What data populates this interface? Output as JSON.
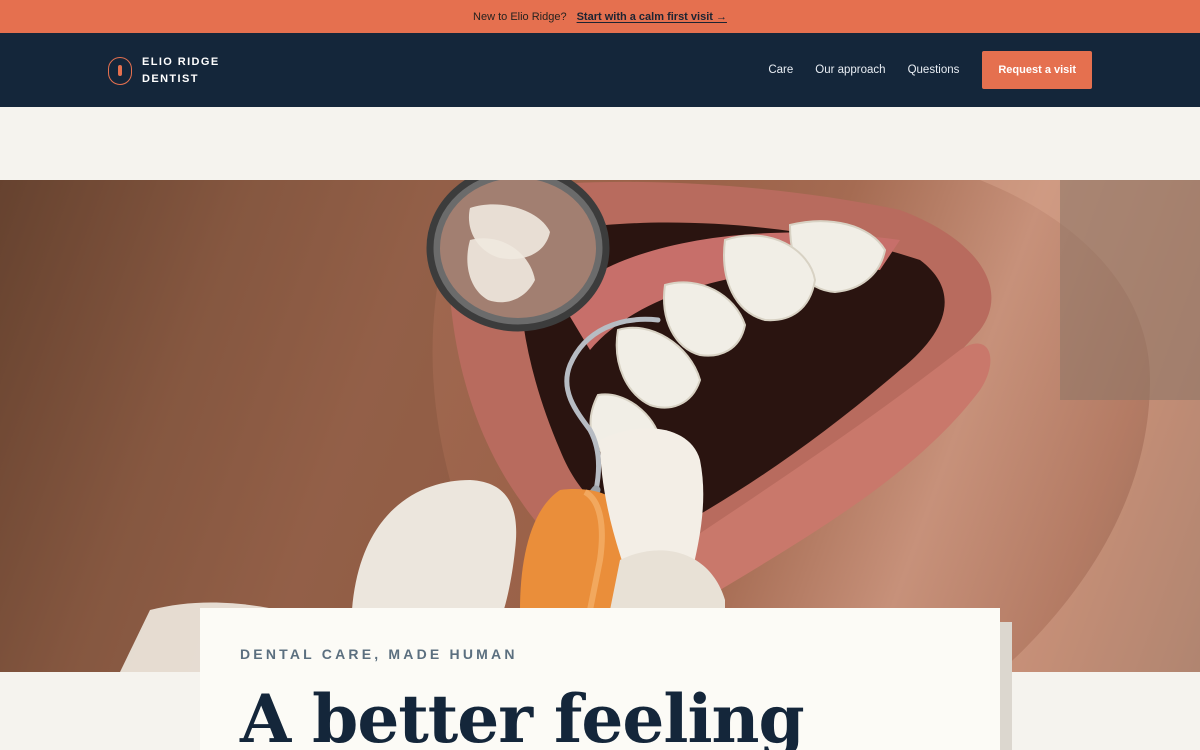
{
  "announcement": {
    "text": "New to Elio Ridge?",
    "link": "Start with a calm first visit →"
  },
  "brand": {
    "line1": "ELIO RIDGE",
    "line2": "DENTIST"
  },
  "nav": {
    "items": [
      {
        "label": "Care"
      },
      {
        "label": "Our approach"
      },
      {
        "label": "Questions"
      }
    ],
    "cta": "Request a visit"
  },
  "hero": {
    "image": "dental-exam-photo"
  },
  "intro": {
    "eyebrow": "DENTAL CARE, MADE HUMAN",
    "headline": "A better feeling"
  },
  "colors": {
    "accent": "#e5704f",
    "navy": "#14263a",
    "cream": "#f5f3ee",
    "card": "#fcfbf6"
  }
}
